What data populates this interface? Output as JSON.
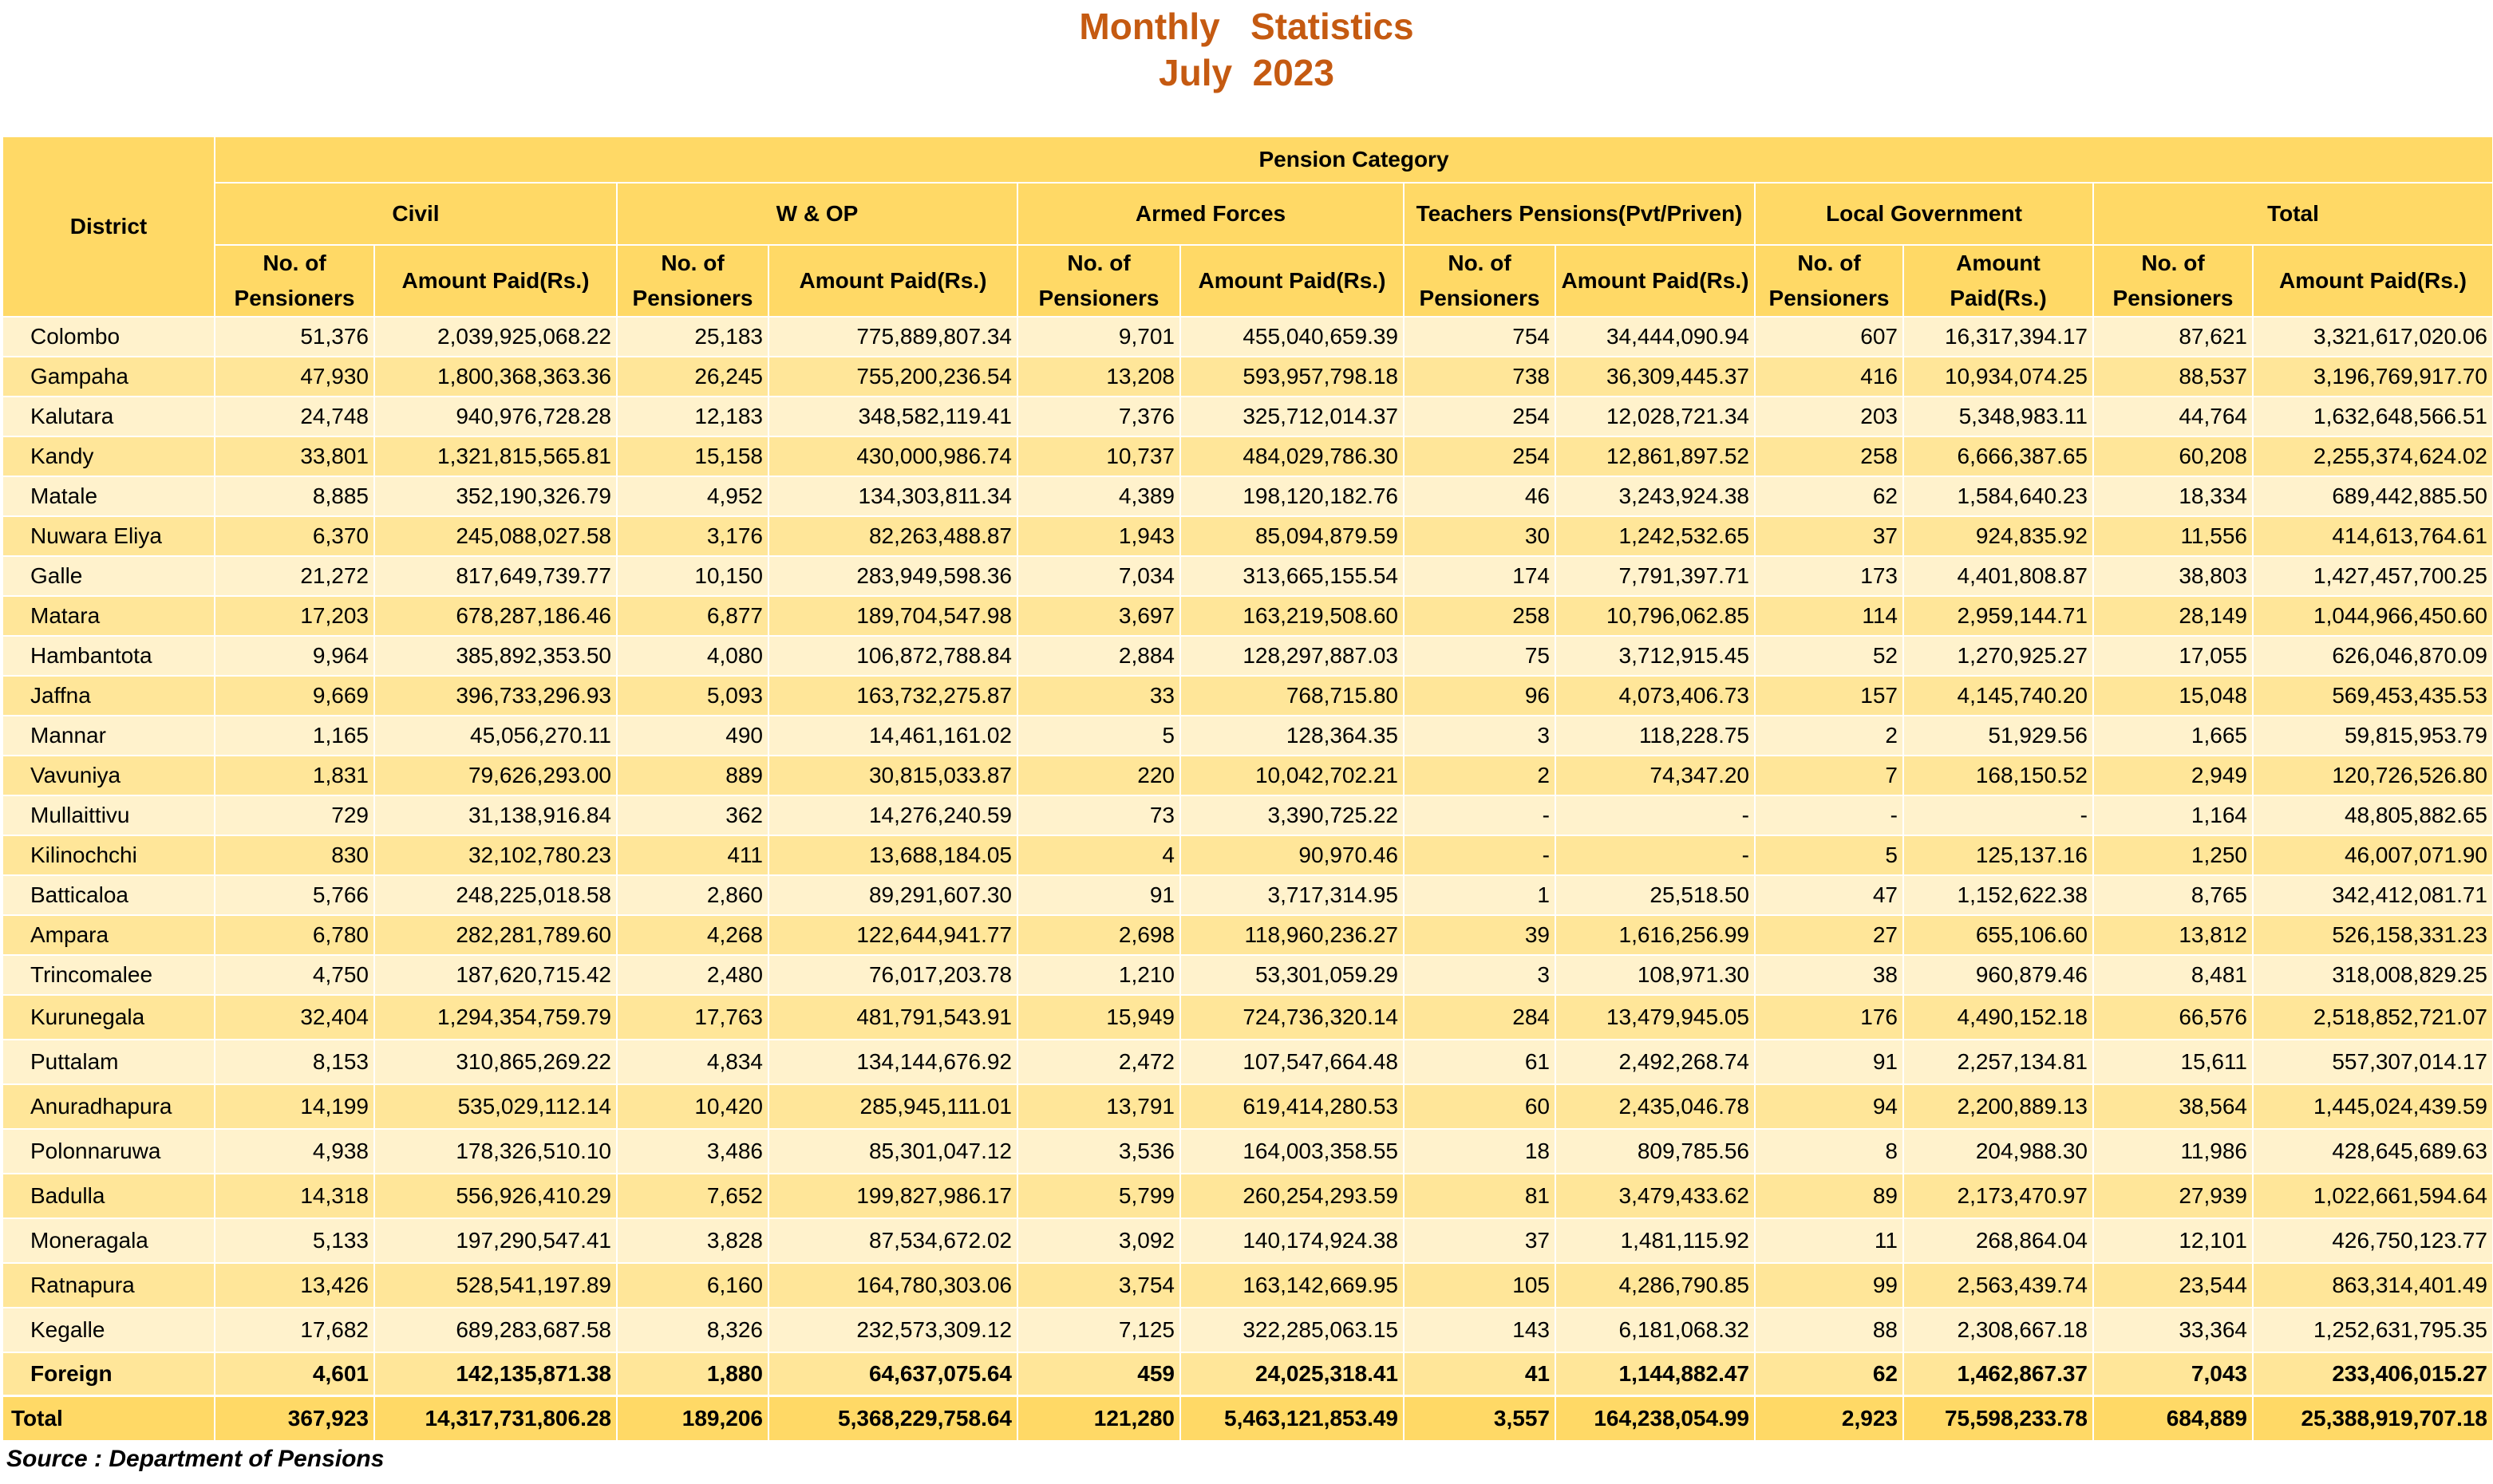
{
  "title": {
    "line1": "Monthly   Statistics",
    "line2": "July  2023"
  },
  "header": {
    "district": "District",
    "pension_category": "Pension Category",
    "groups": [
      "Civil",
      "W & OP",
      "Armed Forces",
      "Teachers Pensions(Pvt/Priven)",
      "Local Government",
      "Total"
    ],
    "sub": {
      "no": "No. of Pensioners",
      "amount": "Amount Paid(Rs.)"
    }
  },
  "rows": [
    [
      "Colombo",
      "51,376",
      "2,039,925,068.22",
      "25,183",
      "775,889,807.34",
      "9,701",
      "455,040,659.39",
      "754",
      "34,444,090.94",
      "607",
      "16,317,394.17",
      "87,621",
      "3,321,617,020.06"
    ],
    [
      "Gampaha",
      "47,930",
      "1,800,368,363.36",
      "26,245",
      "755,200,236.54",
      "13,208",
      "593,957,798.18",
      "738",
      "36,309,445.37",
      "416",
      "10,934,074.25",
      "88,537",
      "3,196,769,917.70"
    ],
    [
      "Kalutara",
      "24,748",
      "940,976,728.28",
      "12,183",
      "348,582,119.41",
      "7,376",
      "325,712,014.37",
      "254",
      "12,028,721.34",
      "203",
      "5,348,983.11",
      "44,764",
      "1,632,648,566.51"
    ],
    [
      "Kandy",
      "33,801",
      "1,321,815,565.81",
      "15,158",
      "430,000,986.74",
      "10,737",
      "484,029,786.30",
      "254",
      "12,861,897.52",
      "258",
      "6,666,387.65",
      "60,208",
      "2,255,374,624.02"
    ],
    [
      "Matale",
      "8,885",
      "352,190,326.79",
      "4,952",
      "134,303,811.34",
      "4,389",
      "198,120,182.76",
      "46",
      "3,243,924.38",
      "62",
      "1,584,640.23",
      "18,334",
      "689,442,885.50"
    ],
    [
      "Nuwara Eliya",
      "6,370",
      "245,088,027.58",
      "3,176",
      "82,263,488.87",
      "1,943",
      "85,094,879.59",
      "30",
      "1,242,532.65",
      "37",
      "924,835.92",
      "11,556",
      "414,613,764.61"
    ],
    [
      "Galle",
      "21,272",
      "817,649,739.77",
      "10,150",
      "283,949,598.36",
      "7,034",
      "313,665,155.54",
      "174",
      "7,791,397.71",
      "173",
      "4,401,808.87",
      "38,803",
      "1,427,457,700.25"
    ],
    [
      "Matara",
      "17,203",
      "678,287,186.46",
      "6,877",
      "189,704,547.98",
      "3,697",
      "163,219,508.60",
      "258",
      "10,796,062.85",
      "114",
      "2,959,144.71",
      "28,149",
      "1,044,966,450.60"
    ],
    [
      "Hambantota",
      "9,964",
      "385,892,353.50",
      "4,080",
      "106,872,788.84",
      "2,884",
      "128,297,887.03",
      "75",
      "3,712,915.45",
      "52",
      "1,270,925.27",
      "17,055",
      "626,046,870.09"
    ],
    [
      "Jaffna",
      "9,669",
      "396,733,296.93",
      "5,093",
      "163,732,275.87",
      "33",
      "768,715.80",
      "96",
      "4,073,406.73",
      "157",
      "4,145,740.20",
      "15,048",
      "569,453,435.53"
    ],
    [
      "Mannar",
      "1,165",
      "45,056,270.11",
      "490",
      "14,461,161.02",
      "5",
      "128,364.35",
      "3",
      "118,228.75",
      "2",
      "51,929.56",
      "1,665",
      "59,815,953.79"
    ],
    [
      "Vavuniya",
      "1,831",
      "79,626,293.00",
      "889",
      "30,815,033.87",
      "220",
      "10,042,702.21",
      "2",
      "74,347.20",
      "7",
      "168,150.52",
      "2,949",
      "120,726,526.80"
    ],
    [
      "Mullaittivu",
      "729",
      "31,138,916.84",
      "362",
      "14,276,240.59",
      "73",
      "3,390,725.22",
      "-",
      "-",
      "-",
      "-",
      "1,164",
      "48,805,882.65"
    ],
    [
      "Kilinochchi",
      "830",
      "32,102,780.23",
      "411",
      "13,688,184.05",
      "4",
      "90,970.46",
      "-",
      "-",
      "5",
      "125,137.16",
      "1,250",
      "46,007,071.90"
    ],
    [
      "Batticaloa",
      "5,766",
      "248,225,018.58",
      "2,860",
      "89,291,607.30",
      "91",
      "3,717,314.95",
      "1",
      "25,518.50",
      "47",
      "1,152,622.38",
      "8,765",
      "342,412,081.71"
    ],
    [
      "Ampara",
      "6,780",
      "282,281,789.60",
      "4,268",
      "122,644,941.77",
      "2,698",
      "118,960,236.27",
      "39",
      "1,616,256.99",
      "27",
      "655,106.60",
      "13,812",
      "526,158,331.23"
    ],
    [
      "Trincomalee",
      "4,750",
      "187,620,715.42",
      "2,480",
      "76,017,203.78",
      "1,210",
      "53,301,059.29",
      "3",
      "108,971.30",
      "38",
      "960,879.46",
      "8,481",
      "318,008,829.25"
    ],
    [
      "Kurunegala",
      "32,404",
      "1,294,354,759.79",
      "17,763",
      "481,791,543.91",
      "15,949",
      "724,736,320.14",
      "284",
      "13,479,945.05",
      "176",
      "4,490,152.18",
      "66,576",
      "2,518,852,721.07"
    ],
    [
      "Puttalam",
      "8,153",
      "310,865,269.22",
      "4,834",
      "134,144,676.92",
      "2,472",
      "107,547,664.48",
      "61",
      "2,492,268.74",
      "91",
      "2,257,134.81",
      "15,611",
      "557,307,014.17"
    ],
    [
      "Anuradhapura",
      "14,199",
      "535,029,112.14",
      "10,420",
      "285,945,111.01",
      "13,791",
      "619,414,280.53",
      "60",
      "2,435,046.78",
      "94",
      "2,200,889.13",
      "38,564",
      "1,445,024,439.59"
    ],
    [
      "Polonnaruwa",
      "4,938",
      "178,326,510.10",
      "3,486",
      "85,301,047.12",
      "3,536",
      "164,003,358.55",
      "18",
      "809,785.56",
      "8",
      "204,988.30",
      "11,986",
      "428,645,689.63"
    ],
    [
      "Badulla",
      "14,318",
      "556,926,410.29",
      "7,652",
      "199,827,986.17",
      "5,799",
      "260,254,293.59",
      "81",
      "3,479,433.62",
      "89",
      "2,173,470.97",
      "27,939",
      "1,022,661,594.64"
    ],
    [
      "Moneragala",
      "5,133",
      "197,290,547.41",
      "3,828",
      "87,534,672.02",
      "3,092",
      "140,174,924.38",
      "37",
      "1,481,115.92",
      "11",
      "268,864.04",
      "12,101",
      "426,750,123.77"
    ],
    [
      "Ratnapura",
      "13,426",
      "528,541,197.89",
      "6,160",
      "164,780,303.06",
      "3,754",
      "163,142,669.95",
      "105",
      "4,286,790.85",
      "99",
      "2,563,439.74",
      "23,544",
      "863,314,401.49"
    ],
    [
      "Kegalle",
      "17,682",
      "689,283,687.58",
      "8,326",
      "232,573,309.12",
      "7,125",
      "322,285,063.15",
      "143",
      "6,181,068.32",
      "88",
      "2,308,667.18",
      "33,364",
      "1,252,631,795.35"
    ]
  ],
  "foreign": [
    "Foreign",
    "4,601",
    "142,135,871.38",
    "1,880",
    "64,637,075.64",
    "459",
    "24,025,318.41",
    "41",
    "1,144,882.47",
    "62",
    "1,462,867.37",
    "7,043",
    "233,406,015.27"
  ],
  "total": [
    "Total",
    "367,923",
    "14,317,731,806.28",
    "189,206",
    "5,368,229,758.64",
    "121,280",
    "5,463,121,853.49",
    "3,557",
    "164,238,054.99",
    "2,923",
    "75,598,233.78",
    "684,889",
    "25,388,919,707.18"
  ],
  "source": "Source : Department of Pensions"
}
